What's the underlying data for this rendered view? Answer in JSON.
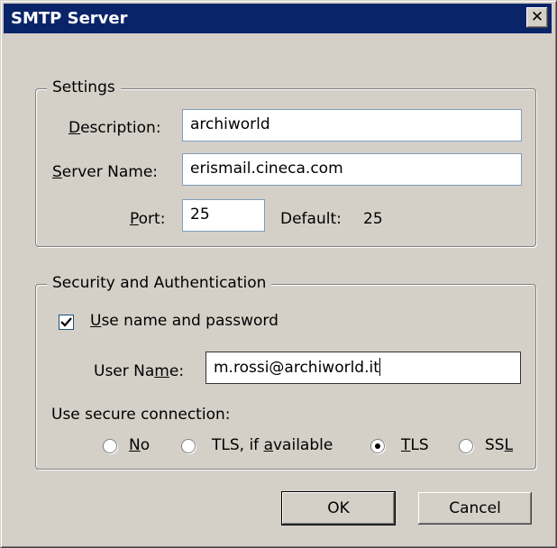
{
  "window": {
    "title": "SMTP Server",
    "close_glyph": "✕"
  },
  "settings": {
    "legend": "Settings",
    "description": {
      "label_pre": "",
      "mnemonic": "D",
      "label_post": "escription:",
      "value": "archiworld"
    },
    "server_name": {
      "mnemonic": "S",
      "label_post": "erver Name:",
      "value": "erismail.cineca.com"
    },
    "port": {
      "mnemonic": "P",
      "label_post": "ort:",
      "value": "25"
    },
    "default": {
      "label": "Default:",
      "value": "25"
    }
  },
  "security": {
    "legend": "Security and Authentication",
    "use_name_password": {
      "mnemonic": "U",
      "label_post": "se name and password",
      "checked": true
    },
    "user_name": {
      "label_pre": "User Na",
      "mnemonic": "m",
      "label_post": "e:",
      "value": "m.rossi@archiworld.it"
    },
    "secure_connection_label": "Use secure connection:",
    "options": {
      "no": {
        "mnemonic": "N",
        "label_post": "o",
        "selected": false
      },
      "tls_if_available": {
        "label_pre": "TLS, if ",
        "mnemonic": "a",
        "label_post": "vailable",
        "selected": false
      },
      "tls": {
        "mnemonic": "T",
        "label_post": "LS",
        "selected": true
      },
      "ssl": {
        "label_pre": "SS",
        "mnemonic": "L",
        "selected": false
      }
    }
  },
  "buttons": {
    "ok": "OK",
    "cancel": "Cancel"
  }
}
